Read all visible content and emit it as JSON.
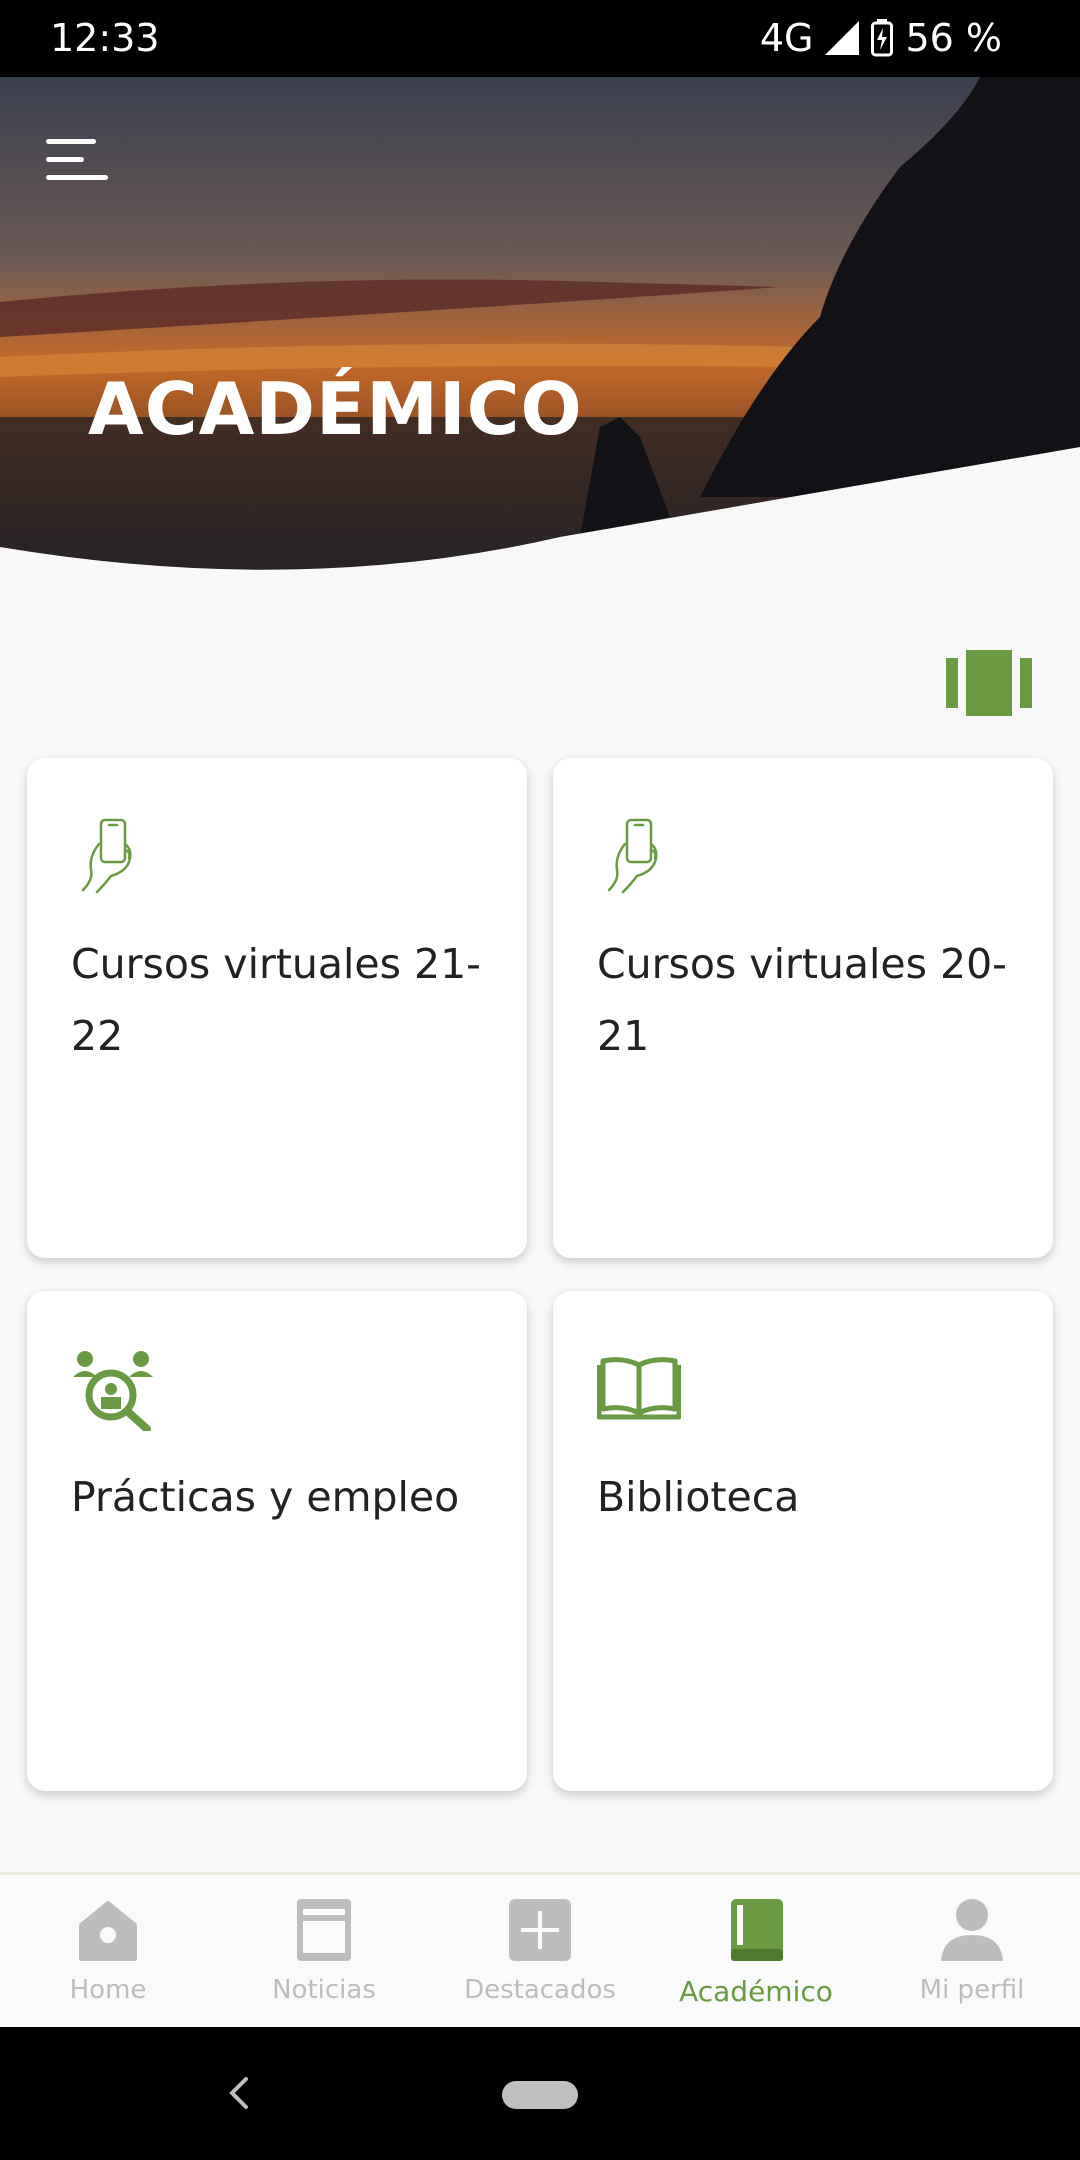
{
  "status_bar": {
    "time": "12:33",
    "network": "4G",
    "battery": "56 %"
  },
  "header": {
    "title": "ACADÉMICO"
  },
  "cards": [
    {
      "title": "Cursos virtuales 21-22",
      "icon": "hand-phone-icon"
    },
    {
      "title": "Cursos virtuales 20-21",
      "icon": "hand-phone-icon"
    },
    {
      "title": "Prácticas y empleo",
      "icon": "job-search-icon"
    },
    {
      "title": "Biblioteca",
      "icon": "open-book-icon"
    }
  ],
  "bottom_nav": [
    {
      "label": "Home",
      "icon": "home-icon",
      "active": false
    },
    {
      "label": "Noticias",
      "icon": "news-icon",
      "active": false
    },
    {
      "label": "Destacados",
      "icon": "plus-box-icon",
      "active": false
    },
    {
      "label": "Académico",
      "icon": "book-icon",
      "active": true
    },
    {
      "label": "Mi perfil",
      "icon": "user-icon",
      "active": false
    }
  ],
  "colors": {
    "accent": "#6a9a42",
    "inactive": "#bdbdbd",
    "text": "#222222"
  }
}
